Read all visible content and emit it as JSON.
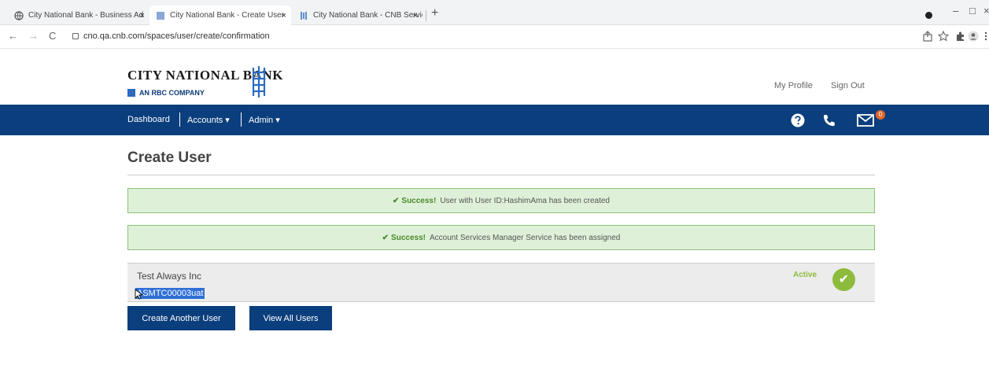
{
  "browser": {
    "tabs": [
      {
        "title": "City National Bank - Business Ad",
        "close": "×"
      },
      {
        "title": "City National Bank - Create User",
        "close": "×"
      },
      {
        "title": "City National Bank - CNB Service",
        "close": "×"
      }
    ],
    "new_tab": "+",
    "window_controls": [
      "–",
      "□",
      "×"
    ],
    "nav": {
      "back": "←",
      "forward": "→",
      "reload": "C"
    },
    "url": "cno.qa.cnb.com/spaces/user/create/confirmation",
    "toolbar_icons": [
      "share-icon",
      "star-icon",
      "extensions-icon",
      "profile-icon",
      "menu-icon"
    ]
  },
  "header": {
    "logo_text": "CITY NATIONAL BANK",
    "logo_sub": "AN RBC COMPANY",
    "my_profile": "My Profile",
    "sign_out": "Sign Out"
  },
  "navbar": {
    "dashboard": "Dashboard",
    "accounts": "Accounts ▾",
    "admin": "Admin ▾",
    "message_badge": "0"
  },
  "main": {
    "title": "Create User",
    "alerts": [
      {
        "icon": "✔",
        "label": "Success!",
        "text": "User with User ID:HashimAma has been created"
      },
      {
        "icon": "✔",
        "label": "Success!",
        "text": "Account Services Manager Service has been assigned"
      }
    ],
    "account": {
      "name": "Test Always Inc",
      "id": "ASMTC00003uat",
      "status": "Active",
      "status_icon": "✔"
    },
    "buttons": {
      "create_another": "Create Another User",
      "view_all": "View All Users"
    }
  },
  "colors": {
    "brand_navy": "#0b3e7c",
    "success_bg": "#dff0d8",
    "success_border": "#8cc37a",
    "active_green": "#8dbb3c",
    "badge_orange": "#e2682b"
  }
}
